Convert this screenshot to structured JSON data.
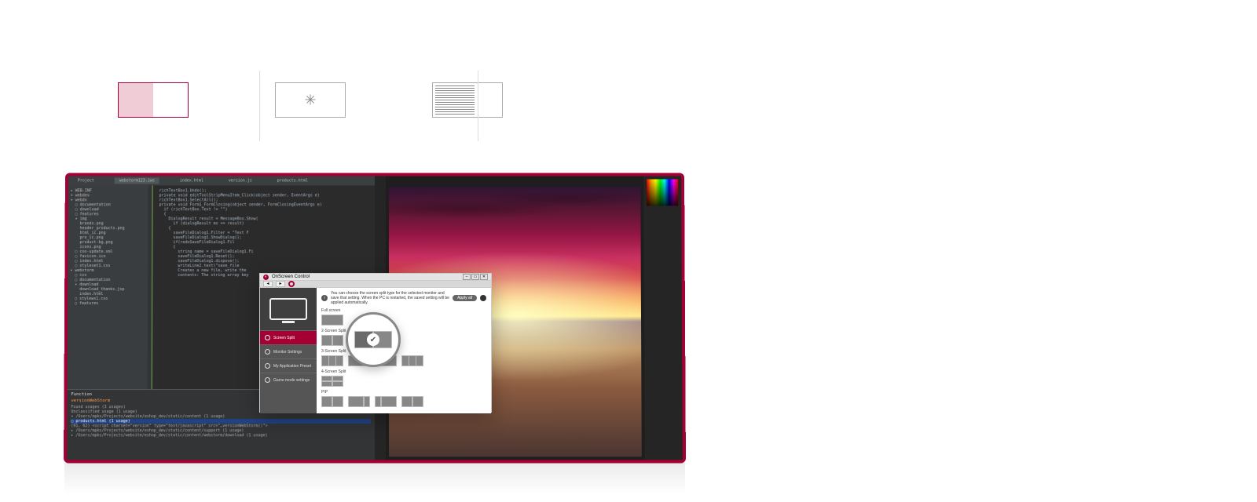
{
  "tabs": {
    "split_label": "",
    "loading_label": "",
    "striped_label": ""
  },
  "ide": {
    "panel_title": "Project",
    "open_tabs": [
      "webstorm123.iws",
      "index.html",
      "version.js",
      "products.html"
    ],
    "tree": [
      "▸ WEB-INF",
      "▾ webdev",
      "▾ webdx",
      "  ▢ documentation",
      "  ▢ download",
      "  ▢ features",
      "  ▾ img",
      "    brands.png",
      "    header_products.png",
      "    html_ic.png",
      "    pro_ic.png",
      "    product-bg.png",
      "    icons.png",
      "  ▢ coo-update.xml",
      "  ▢ favicon.ico",
      "  ▢ index.html",
      "  ▢ styleset1.css",
      "▾ webstorm",
      "  ▢ css",
      "  ▢ documentation",
      "  ▾ download",
      "    download_thanks.jsp",
      "    index.html",
      "  ▢ stylews1.css",
      "  ▢ features"
    ],
    "code": [
      "richTextBox1.Undo();",
      "",
      "private void editToolStripMenuItem_Click(object sender, EventArgs e)",
      "",
      "richTextBox1.SelectAll();",
      "",
      "private void Form1_FormClosing(object sender, FormClosingEventArgs e)",
      "",
      "  if (richTextBox.Text != \"\")",
      "  {",
      "    DialogResult result = MessageBox.Show(",
      "      if (dialogResult ms == result)",
      "    {",
      "      saveFileDialog1.Filter = \"Text F",
      "      saveFileDialog1.ShowDialog();",
      "      if(redoSaveFileDialog1.Fil",
      "      {",
      "        string name = saveFileDialog1.Fi",
      "        saveFileDialog1.Reset();",
      "        saveFileDialog1.dispose();",
      "        writeLine2.text(\"save_file",
      "        Creates a new file, write the",
      "        contents: The string array key"
    ],
    "find": {
      "title": "Function",
      "subtitle": "versionWebStorm",
      "groups": [
        "Found usages (3 usages)",
        "Unclassified usage (1 usage)",
        "  ▾ /Users/mpks/Projects/website/eshop_dev/static/content (1 usage)",
        "    ▢ products.html (1 usage)",
        "      (91, 62) <script charset=\"version\" type=\"text/javascript\" src=\"…versionWebStorm()\">",
        "  ▸ /Users/mpks/Projects/website/eshop_dev/static/content/support (1 usage)",
        "  ▸ /Users/mpks/Projects/website/eshop_dev/static/content/webstorm/download (1 usage)"
      ]
    }
  },
  "osc": {
    "title": "OnScreen Control",
    "info": "You can choose the screen split type for the selected monitor and save that setting. When the PC is restarted, the saved setting will be applied automatically.",
    "apply_all": "Apply all",
    "menu": [
      "Screen Split",
      "Monitor Settings",
      "My Application Preset",
      "Game mode settings"
    ],
    "sections": {
      "full": "Full screen",
      "two": "2-Screen Split",
      "three": "3-Screen Split",
      "four": "4-Screen Split",
      "pip": "PIP"
    }
  }
}
